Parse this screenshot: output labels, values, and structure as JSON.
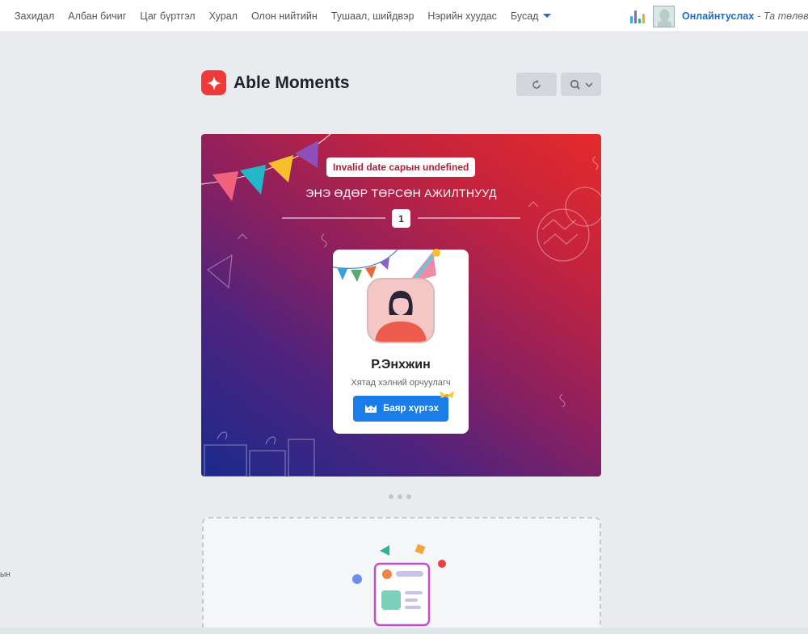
{
  "nav": {
    "items": [
      {
        "label": "Захидал"
      },
      {
        "label": "Албан бичиг"
      },
      {
        "label": "Цаг бүртгэл"
      },
      {
        "label": "Хурал"
      },
      {
        "label": "Олон нийтийн"
      },
      {
        "label": "Тушаал, шийдвэр"
      },
      {
        "label": "Нэрийн хуудас"
      },
      {
        "label": "Бусад"
      }
    ],
    "user_name": "Онлайнтуслах",
    "status_text": "- Та төлөв"
  },
  "header": {
    "title": "Able Moments",
    "refresh_icon": "refresh-icon",
    "search_icon": "search-icon",
    "chevron_icon": "chevron-down-icon"
  },
  "birthday": {
    "date_label": "Invalid date сарын undefined",
    "heading": "ЭНЭ ӨДӨР ТӨРСӨН АЖИЛТНУУД",
    "count": "1",
    "person": {
      "name": "Р.Энхжин",
      "role": "Хятад хэлний орчуулагч"
    },
    "button_label": "Баяр хүргэх"
  },
  "side_text": "ын",
  "colors": {
    "accent_blue": "#1b7ee8",
    "brand_red": "#f03a3a",
    "gradient_top": "#e52a2a",
    "gradient_bottom": "#1a2a8c"
  }
}
